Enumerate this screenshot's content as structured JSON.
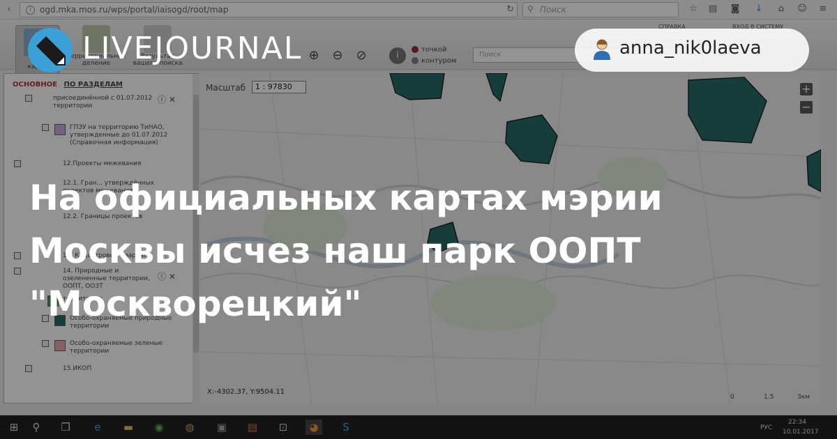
{
  "browser": {
    "url": "ogd.mka.mos.ru/wps/portal/iaisogd/root/map",
    "search_placeholder": "Поиск"
  },
  "app": {
    "system_links": {
      "help": "СПРАВКА",
      "login": "ВХОД В СИСТЕМУ"
    },
    "tools": {
      "layers": "Слои карты",
      "territorial": "Территориальное деление",
      "results": "Результат вашего поиска"
    },
    "display_mode": {
      "point": "точкой",
      "contour": "контуром"
    },
    "map_search_placeholder": "Поиск",
    "sidebar": {
      "tab_main": "ОСНОВНОЕ",
      "tab_sections": "ПО РАЗДЕЛАМ",
      "layers": [
        {
          "label": "присоединённой с 01.07.2012 территории"
        },
        {
          "label": "ГПЗУ на территорию ТиНАО, утвержденные до 01.07.2012 (Справочная информация)"
        },
        {
          "label": "12.Проекты межевания"
        },
        {
          "label": "12.1. Гран... утверждённых проектов межевания"
        },
        {
          "label": "12.2. Границы проектов"
        },
        {
          "label": "13. Кадастровые кварталы"
        },
        {
          "label": "14. Природные и озелененные территории, ООПТ, ООЗТ"
        },
        {
          "label": "территории"
        },
        {
          "label": "Особо-охраняемые природные территории"
        },
        {
          "label": "Особо-охраняемые зеленые территории"
        },
        {
          "label": "15.ИКОП"
        }
      ]
    },
    "map": {
      "scale_label": "Масштаб",
      "scale_value": "1 : 97830",
      "coords": "X:-4302.37, Y:9504.11",
      "scalebar": [
        "0",
        "1.5",
        "3км"
      ]
    }
  },
  "taskbar": {
    "lang": "РУС",
    "time": "22:34",
    "date": "10.01.2017"
  },
  "overlay": {
    "brand": "LIVEJOURNAL",
    "username": "anna_nik0laeva",
    "headline": "На официальных картах мэрии Москвы исчез наш парк ООПТ \"Москворецкий\""
  },
  "colors": {
    "oopt_fill": "#0f5a58",
    "lj_blue": "#3aa0d5",
    "tab_red": "#b01c1c"
  }
}
